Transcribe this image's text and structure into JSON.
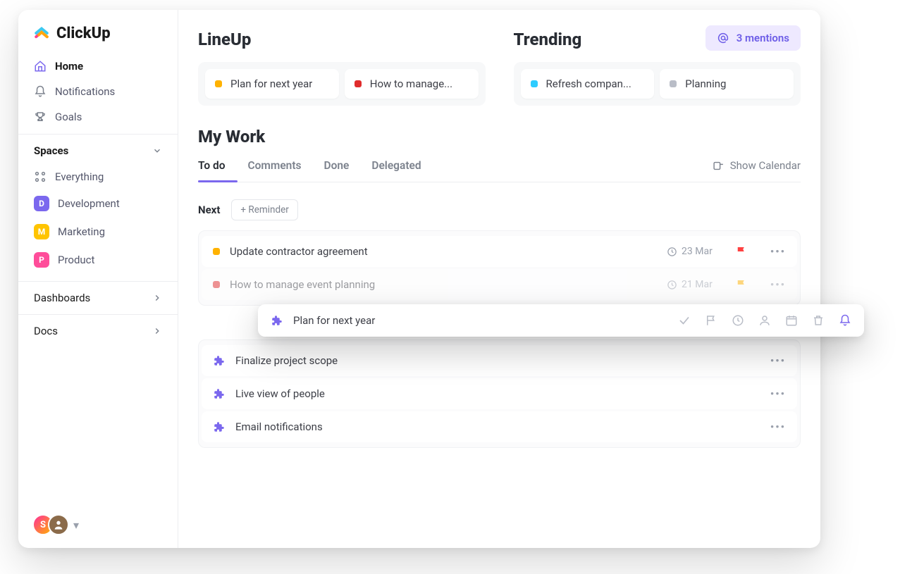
{
  "brand": {
    "name": "ClickUp"
  },
  "mentions": {
    "label": "3 mentions"
  },
  "sidebar": {
    "nav": [
      {
        "label": "Home",
        "active": true
      },
      {
        "label": "Notifications"
      },
      {
        "label": "Goals"
      }
    ],
    "spaces_header": "Spaces",
    "everything_label": "Everything",
    "spaces": [
      {
        "letter": "D",
        "label": "Development",
        "color": "#7B68EE"
      },
      {
        "letter": "M",
        "label": "Marketing",
        "color": "#FFC400"
      },
      {
        "letter": "P",
        "label": "Product",
        "color": "#FF4D9A"
      }
    ],
    "footer": [
      {
        "label": "Dashboards"
      },
      {
        "label": "Docs"
      }
    ],
    "avatars": {
      "initial": "S"
    }
  },
  "lineup": {
    "title": "LineUp",
    "cards": [
      {
        "color": "#FFB200",
        "label": "Plan for next year"
      },
      {
        "color": "#E02C2C",
        "label": "How to manage..."
      }
    ]
  },
  "trending": {
    "title": "Trending",
    "cards": [
      {
        "color": "#2DCCFF",
        "label": "Refresh compan..."
      },
      {
        "color": "#B9BDC7",
        "label": "Planning"
      }
    ]
  },
  "mywork": {
    "title": "My Work",
    "tabs": [
      {
        "label": "To do",
        "active": true
      },
      {
        "label": "Comments"
      },
      {
        "label": "Done"
      },
      {
        "label": "Delegated"
      }
    ],
    "show_calendar": "Show Calendar",
    "next_label": "Next",
    "reminder_btn": "+ Reminder",
    "next_tasks": [
      {
        "color": "#FFB200",
        "label": "Update contractor agreement",
        "date": "23 Mar",
        "flag_color": "#FF4040"
      },
      {
        "color": "#E02C2C",
        "label": "How to manage event planning",
        "date": "21 Mar",
        "flag_color": "#FFB200"
      }
    ],
    "later_tasks": [
      {
        "label": "Finalize project scope"
      },
      {
        "label": "Live view of people"
      },
      {
        "label": "Email notifications"
      }
    ]
  },
  "popover": {
    "title": "Plan for next year"
  }
}
